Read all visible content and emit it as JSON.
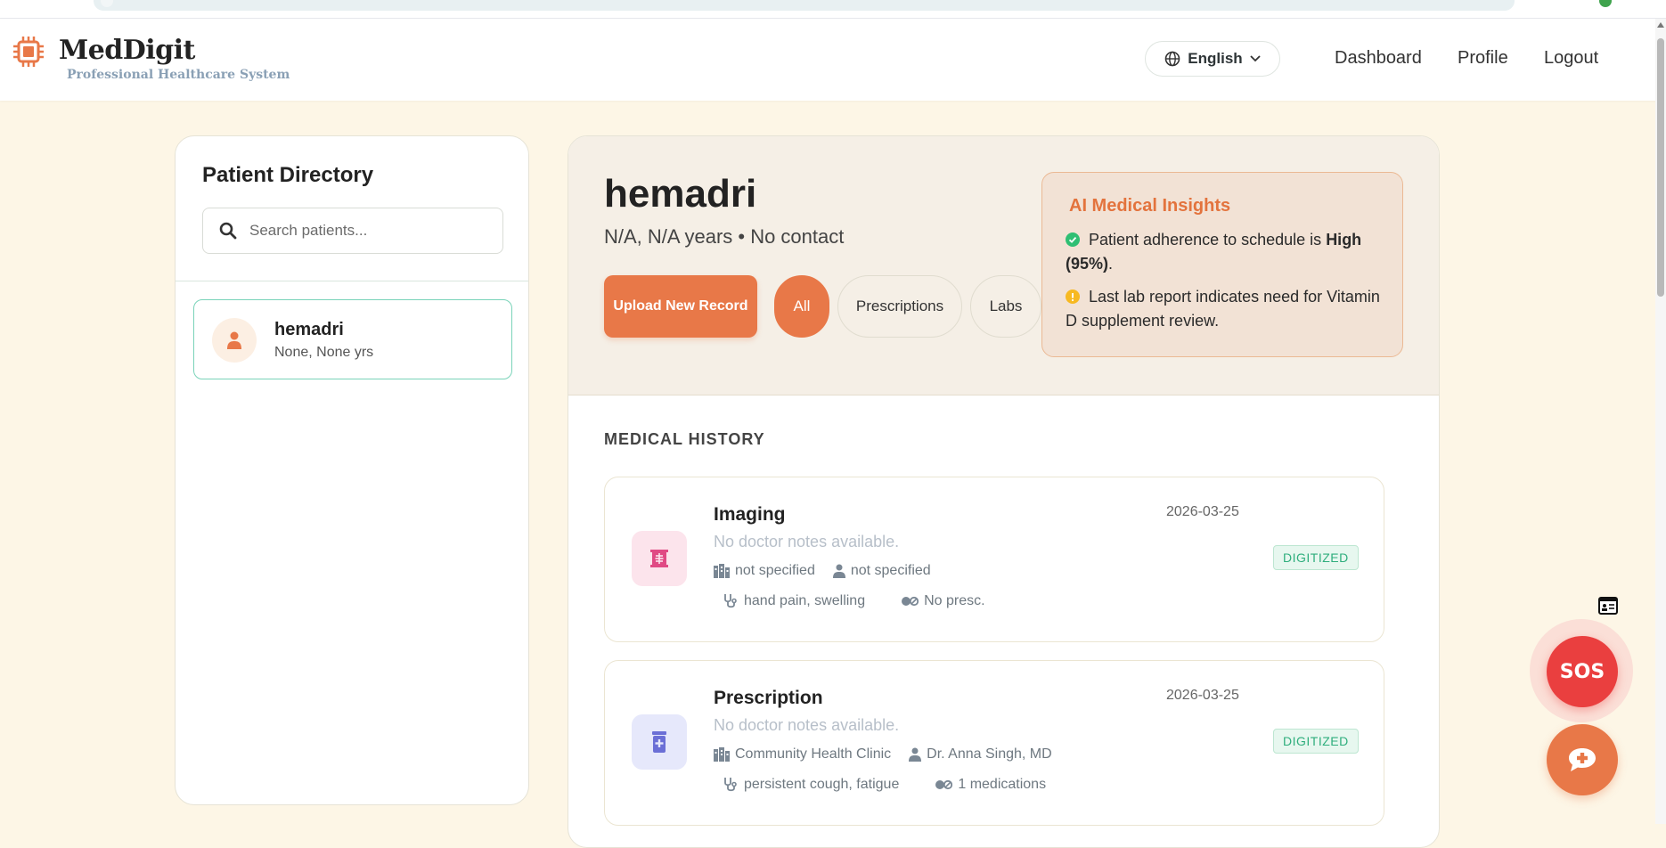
{
  "header": {
    "brand": "MedDigit",
    "tagline": "Professional Healthcare System",
    "language": "English",
    "nav": {
      "dashboard": "Dashboard",
      "profile": "Profile",
      "logout": "Logout"
    }
  },
  "sidebar": {
    "title": "Patient Directory",
    "search_placeholder": "Search patients...",
    "patients": [
      {
        "name": "hemadri",
        "details": "None, None yrs"
      }
    ]
  },
  "patient": {
    "name": "hemadri",
    "meta": "N/A, N/A years • No contact"
  },
  "actions": {
    "upload": "Upload New Record",
    "filters": [
      "All",
      "Prescriptions",
      "Labs"
    ],
    "active_filter": "All"
  },
  "insights": {
    "title": "AI Medical Insights",
    "items": [
      {
        "text_before": "Patient adherence to schedule is ",
        "strong": "High (95%)",
        "text_after": ".",
        "status": "success"
      },
      {
        "text": "Last lab report indicates need for Vitamin D supplement review.",
        "status": "warning"
      }
    ]
  },
  "history": {
    "title": "MEDICAL HISTORY",
    "records": [
      {
        "type": "Imaging",
        "notes": "No doctor notes available.",
        "facility": "not specified",
        "doctor": "not specified",
        "symptoms": "hand pain, swelling",
        "prescription": "No presc.",
        "date": "2026-03-25",
        "status": "DIGITIZED",
        "icon": "xray-icon"
      },
      {
        "type": "Prescription",
        "notes": "No doctor notes available.",
        "facility": "Community Health Clinic",
        "doctor": "Dr. Anna Singh, MD",
        "symptoms": "persistent cough, fatigue",
        "prescription": "1 medications",
        "date": "2026-03-25",
        "status": "DIGITIZED",
        "icon": "medicine-bottle-icon"
      }
    ]
  },
  "floating": {
    "sos": "SOS"
  },
  "colors": {
    "accent": "#e87848",
    "background": "#fdf6e6",
    "sos": "#ea3f3f",
    "digitized": "#2fae7d"
  }
}
